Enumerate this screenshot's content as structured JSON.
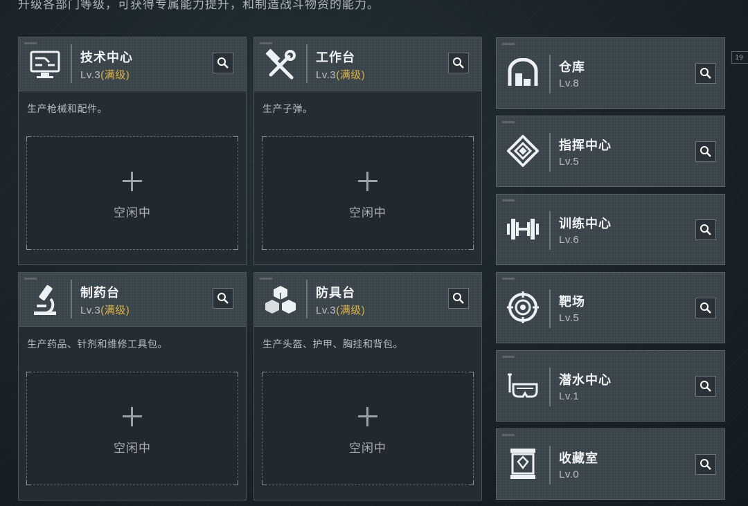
{
  "top_description": "升级各部门等级，可获得专属能力提升，和制造战斗物资的能力。",
  "side_ticker": "19",
  "facilities": [
    {
      "name": "技术中心",
      "level": "Lv.3",
      "max_label": "(满级)",
      "icon": "computer-icon",
      "desc": "生产枪械和配件。",
      "slot_label": "空闲中"
    },
    {
      "name": "工作台",
      "level": "Lv.3",
      "max_label": "(满级)",
      "icon": "hammer-wrench-icon",
      "desc": "生产子弹。",
      "slot_label": "空闲中"
    },
    {
      "name": "制药台",
      "level": "Lv.3",
      "max_label": "(满级)",
      "icon": "microscope-icon",
      "desc": "生产药品、针剂和维修工具包。",
      "slot_label": "空闲中"
    },
    {
      "name": "防具台",
      "level": "Lv.3",
      "max_label": "(满级)",
      "icon": "cubes-icon",
      "desc": "生产头盔、护甲、胸挂和背包。",
      "slot_label": "空闲中"
    }
  ],
  "side_facilities": [
    {
      "name": "仓库",
      "level": "Lv.8",
      "icon": "warehouse-icon"
    },
    {
      "name": "指挥中心",
      "level": "Lv.5",
      "icon": "command-emblem-icon"
    },
    {
      "name": "训练中心",
      "level": "Lv.6",
      "icon": "dumbbell-icon"
    },
    {
      "name": "靶场",
      "level": "Lv.5",
      "icon": "target-icon"
    },
    {
      "name": "潜水中心",
      "level": "Lv.1",
      "icon": "diving-mask-icon"
    },
    {
      "name": "收藏室",
      "level": "Lv.0",
      "icon": "display-case-icon"
    }
  ],
  "colors": {
    "max_level": "#e0b545",
    "card_header": "#3a444b",
    "background": "#1a2329"
  }
}
